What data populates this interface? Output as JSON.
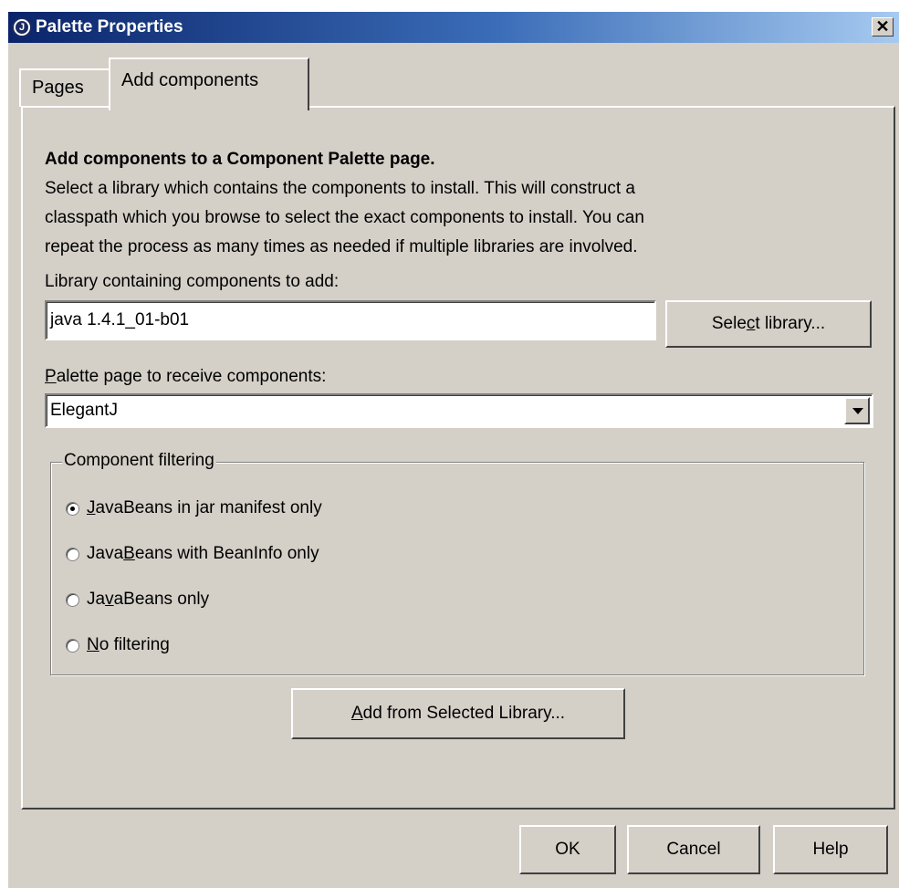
{
  "window": {
    "title": "Palette Properties",
    "close_glyph": "✕",
    "app_icon": "circle-j-icon"
  },
  "tabs": [
    {
      "label": "Pages",
      "active": false
    },
    {
      "label": "Add components",
      "active": true
    }
  ],
  "panel": {
    "heading": "Add components to a Component Palette page.",
    "description_lines": [
      "Select a library which contains the components to install.  This will construct a",
      "classpath which you browse to select the exact components to install.  You can",
      "repeat the process as many times as needed if multiple libraries are involved."
    ],
    "library_label": "Library containing components to add:",
    "library_value": "java 1.4.1_01-b01",
    "select_library": {
      "before": "Sele",
      "mnemonic": "c",
      "after": "t library..."
    },
    "palette_label": {
      "before": "",
      "mnemonic": "P",
      "after": "alette page to receive components:"
    },
    "palette_value": "ElegantJ",
    "filtering": {
      "legend": "Component filtering",
      "options": [
        {
          "before": "",
          "mnemonic": "J",
          "after": "avaBeans in jar manifest only",
          "checked": true
        },
        {
          "before": "Java",
          "mnemonic": "B",
          "after": "eans with BeanInfo only",
          "checked": false
        },
        {
          "before": "Ja",
          "mnemonic": "v",
          "after": "aBeans only",
          "checked": false
        },
        {
          "before": "",
          "mnemonic": "N",
          "after": "o filtering",
          "checked": false
        }
      ]
    },
    "add_button": {
      "before": "",
      "mnemonic": "A",
      "after": "dd from Selected Library..."
    }
  },
  "footer": {
    "ok": "OK",
    "cancel": "Cancel",
    "help": "Help"
  },
  "colors": {
    "face": "#d4d0c8",
    "title_start": "#0a246a",
    "title_end": "#a6caf0"
  }
}
